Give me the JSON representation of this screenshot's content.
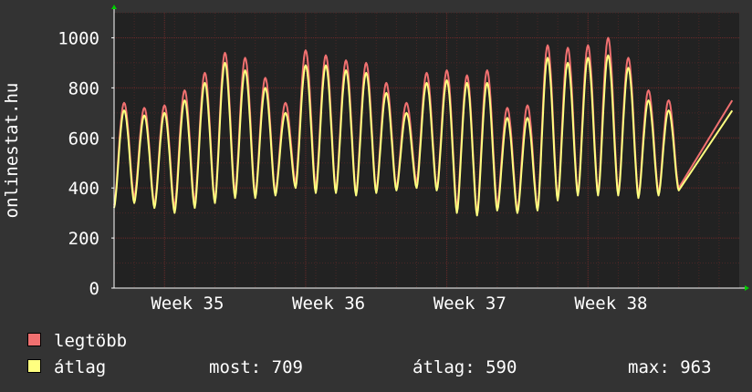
{
  "colors": {
    "background": "#333333",
    "plot_background": "#222222",
    "grid": "#4a2626",
    "axis": "#ffffff",
    "max_series": "#f07070",
    "avg_series": "#ffff80",
    "arrow": "#00cc00"
  },
  "legend": {
    "max_label": "legtöbb",
    "avg_label": "átlag"
  },
  "stats": {
    "most": "most: 709",
    "atlag": "átlag: 590",
    "max": "max: 963"
  },
  "chart_data": {
    "type": "line",
    "ylabel": "onlinestat.hu",
    "ylim": [
      0,
      1100
    ],
    "yticks": [
      0,
      200,
      400,
      600,
      800,
      1000
    ],
    "grid": true,
    "legend_position": "bottom-left",
    "x_unit": "day",
    "x_range": [
      0,
      31
    ],
    "week_ticks": [
      {
        "label": "Week 35",
        "at": 4
      },
      {
        "label": "Week 36",
        "at": 11
      },
      {
        "label": "Week 37",
        "at": 18
      },
      {
        "label": "Week 38",
        "at": 25
      }
    ],
    "series": [
      {
        "name": "legtöbb",
        "daily_low": [
          330,
          360,
          330,
          320,
          340,
          350,
          380,
          370,
          380,
          420,
          400,
          390,
          380,
          390,
          400,
          420,
          400,
          320,
          300,
          330,
          310,
          320,
          360,
          380,
          380,
          380,
          370,
          380,
          400,
          360,
          380
        ],
        "daily_peak": [
          740,
          720,
          730,
          790,
          860,
          940,
          920,
          840,
          740,
          950,
          930,
          910,
          900,
          820,
          740,
          860,
          870,
          850,
          870,
          720,
          730,
          970,
          960,
          970,
          1000,
          920,
          790,
          750
        ]
      },
      {
        "name": "átlag",
        "daily_low": [
          320,
          340,
          320,
          300,
          320,
          340,
          360,
          360,
          370,
          400,
          380,
          380,
          370,
          380,
          390,
          400,
          390,
          300,
          290,
          310,
          300,
          310,
          350,
          370,
          370,
          370,
          360,
          370,
          390,
          350,
          370
        ],
        "daily_peak": [
          710,
          690,
          700,
          750,
          820,
          900,
          870,
          800,
          700,
          890,
          890,
          870,
          860,
          780,
          700,
          820,
          830,
          820,
          820,
          680,
          680,
          920,
          900,
          920,
          930,
          880,
          750,
          710
        ]
      }
    ]
  }
}
